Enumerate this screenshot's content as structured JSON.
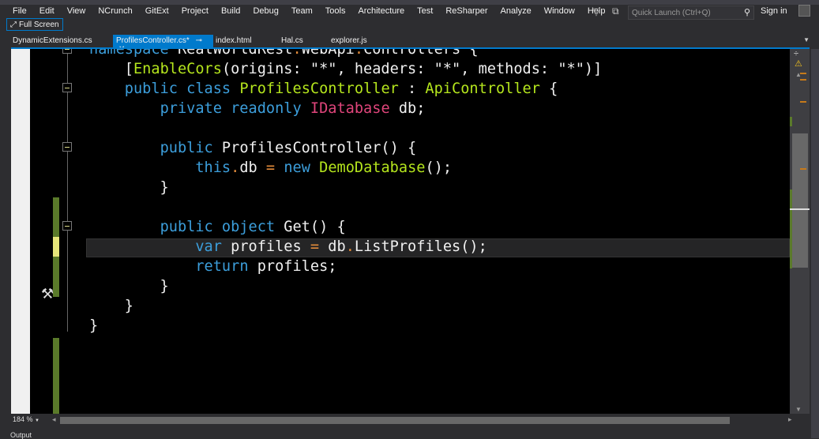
{
  "menu": [
    "File",
    "Edit",
    "View",
    "NCrunch",
    "GitExt",
    "Project",
    "Build",
    "Debug",
    "Team",
    "Tools",
    "Architecture",
    "Test",
    "ReSharper",
    "Analyze",
    "Window",
    "Help"
  ],
  "quick_launch": {
    "placeholder": "Quick Launch (Ctrl+Q)"
  },
  "sign_in": "Sign in",
  "toolbar": {
    "full_screen": "Full Screen"
  },
  "tabs": [
    {
      "label": "DynamicExtensions.cs"
    },
    {
      "label": "ProfilesController.cs*",
      "active": true
    },
    {
      "label": "index.html"
    },
    {
      "label": "Hal.cs"
    },
    {
      "label": "explorer.js"
    }
  ],
  "editor": {
    "zoom": "184 %",
    "namespace": "RealWorldRest",
    "ns2": "WebApi",
    "ns3": "Controllers"
  },
  "status": {
    "output": "Output"
  },
  "colors": {
    "accent": "#007acc",
    "keyword": "#3c9edb",
    "type": "#b5e61d",
    "interface": "#e0457b",
    "change": "#5a7a2a"
  }
}
